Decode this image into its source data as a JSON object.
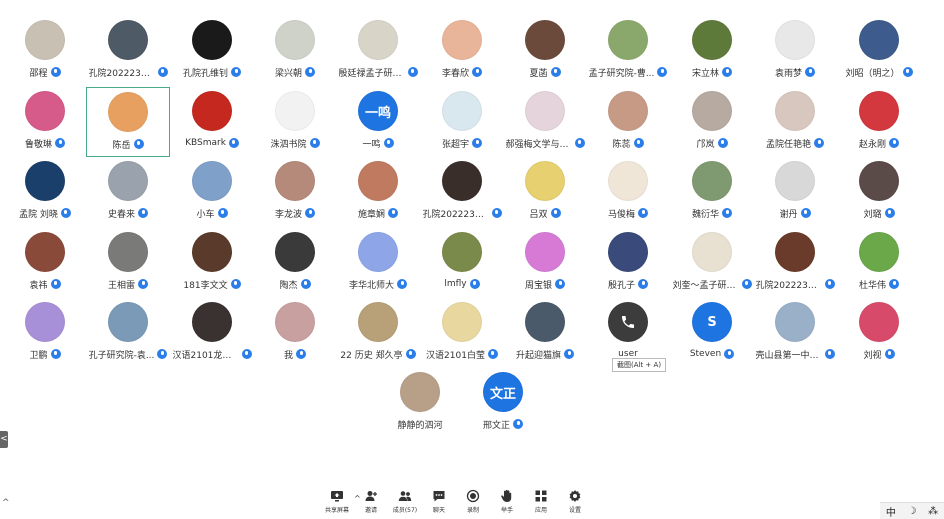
{
  "participants": [
    {
      "name": "邵程",
      "avatar_color": "#c9c0b4"
    },
    {
      "name": "孔院20222312...",
      "avatar_color": "#4e5a66"
    },
    {
      "name": "孔院孔维钊",
      "avatar_color": "#1a1a1a"
    },
    {
      "name": "梁兴朝",
      "avatar_color": "#cfd2c8"
    },
    {
      "name": "殷廷禄孟子研究院",
      "avatar_color": "#d9d4c8"
    },
    {
      "name": "李春欣",
      "avatar_color": "#e9b59a"
    },
    {
      "name": "夏菡",
      "avatar_color": "#6b4a3c"
    },
    {
      "name": "孟子研究院-曹...",
      "avatar_color": "#8aa86b"
    },
    {
      "name": "宋立林",
      "avatar_color": "#5e7a3a"
    },
    {
      "name": "袁雨梦",
      "avatar_color": "#e8e8e8"
    },
    {
      "name": "刘昭（明之）",
      "avatar_color": "#3d5b8c"
    },
    {
      "name": "鲁敬琳",
      "avatar_color": "#d65a8a"
    },
    {
      "name": "陈岳",
      "avatar_color": "#e8a060",
      "selected": true
    },
    {
      "name": "KBSmark",
      "avatar_color": "#c4281e"
    },
    {
      "name": "洙泗书院",
      "avatar_color": "#f2f2f2"
    },
    {
      "name": "一鸣",
      "avatar_color": "#1e74e0",
      "text": "一鸣"
    },
    {
      "name": "张超宇",
      "avatar_color": "#d9e8ee"
    },
    {
      "name": "郝强梅文学与传...",
      "avatar_color": "#e6d4dc"
    },
    {
      "name": "陈蕊",
      "avatar_color": "#c79a86"
    },
    {
      "name": "邝岚",
      "avatar_color": "#b7aaa0"
    },
    {
      "name": "孟院任艳艳",
      "avatar_color": "#d8c7be"
    },
    {
      "name": "赵永刚",
      "avatar_color": "#d2383d"
    },
    {
      "name": "孟院 刘晓",
      "avatar_color": "#1b3f6b"
    },
    {
      "name": "史春来",
      "avatar_color": "#9aa3ad"
    },
    {
      "name": "小车",
      "avatar_color": "#7ea0c9"
    },
    {
      "name": "李龙波",
      "avatar_color": "#b58a7a"
    },
    {
      "name": "施章娴",
      "avatar_color": "#c07a60"
    },
    {
      "name": "孔院20222311...",
      "avatar_color": "#3a2e2a"
    },
    {
      "name": "吕双",
      "avatar_color": "#e6d070"
    },
    {
      "name": "马俊梅",
      "avatar_color": "#efe6d8"
    },
    {
      "name": "魏衍华",
      "avatar_color": "#7f9a70"
    },
    {
      "name": "谢丹",
      "avatar_color": "#d8d8d8"
    },
    {
      "name": "刘璐",
      "avatar_color": "#5a4a48"
    },
    {
      "name": "袁祎",
      "avatar_color": "#8a4a3a"
    },
    {
      "name": "王相雷",
      "avatar_color": "#7a7a78"
    },
    {
      "name": "181李文文",
      "avatar_color": "#5a3a2a"
    },
    {
      "name": "陶杰",
      "avatar_color": "#3a3a3a"
    },
    {
      "name": "李华北师大",
      "avatar_color": "#8ea6e8"
    },
    {
      "name": "lmfly",
      "avatar_color": "#7a8a4a"
    },
    {
      "name": "周宝银",
      "avatar_color": "#d67ad6"
    },
    {
      "name": "殷孔子",
      "avatar_color": "#3a4a7a"
    },
    {
      "name": "刘奎～孟子研究院",
      "avatar_color": "#e8e0d0"
    },
    {
      "name": "孔院20222312...",
      "avatar_color": "#6a3a2a"
    },
    {
      "name": "杜华伟",
      "avatar_color": "#6aa84a"
    },
    {
      "name": "卫鹏",
      "avatar_color": "#a890d8"
    },
    {
      "name": "孔子研究院-袁...",
      "avatar_color": "#7a9ab8"
    },
    {
      "name": "汉语2101龙永康",
      "avatar_color": "#3a3230"
    },
    {
      "name": "我",
      "avatar_color": "#c8a0a0"
    },
    {
      "name": "22 历史  郑久亭",
      "avatar_color": "#b8a078"
    },
    {
      "name": "汉语2101白莹",
      "avatar_color": "#e8d8a0"
    },
    {
      "name": "升起迎猫旗",
      "avatar_color": "#4a5a6a"
    },
    {
      "name": "user",
      "avatar_color": "#3c3c3c",
      "phone": true,
      "no_mic": true
    },
    {
      "name": "Steven",
      "avatar_color": "#1e74e0",
      "text": "S"
    },
    {
      "name": "壳山县第一中学...",
      "avatar_color": "#9ab0c8"
    },
    {
      "name": "刘视",
      "avatar_color": "#d84a6a"
    },
    {
      "name": "静静的泗河",
      "avatar_color": "#b8a088",
      "no_mic": true
    },
    {
      "name": "邢文正",
      "avatar_color": "#1e74e0",
      "text": "文正"
    }
  ],
  "tooltip": "截图(Alt + A)",
  "side_tab": "<",
  "toolbar": [
    {
      "label": "共享屏幕",
      "icon": "share-screen-icon"
    },
    {
      "label": "邀请",
      "icon": "invite-icon"
    },
    {
      "label": "成员(57)",
      "icon": "members-icon"
    },
    {
      "label": "聊天",
      "icon": "chat-icon"
    },
    {
      "label": "录制",
      "icon": "record-icon"
    },
    {
      "label": "举手",
      "icon": "raise-hand-icon"
    },
    {
      "label": "应用",
      "icon": "apps-icon"
    },
    {
      "label": "设置",
      "icon": "settings-icon"
    }
  ],
  "ime": {
    "lang": "中",
    "moon": "☽",
    "dots": "⁂"
  },
  "colors": {
    "accent": "#2b7de9",
    "selected_border": "#4aa88a"
  }
}
